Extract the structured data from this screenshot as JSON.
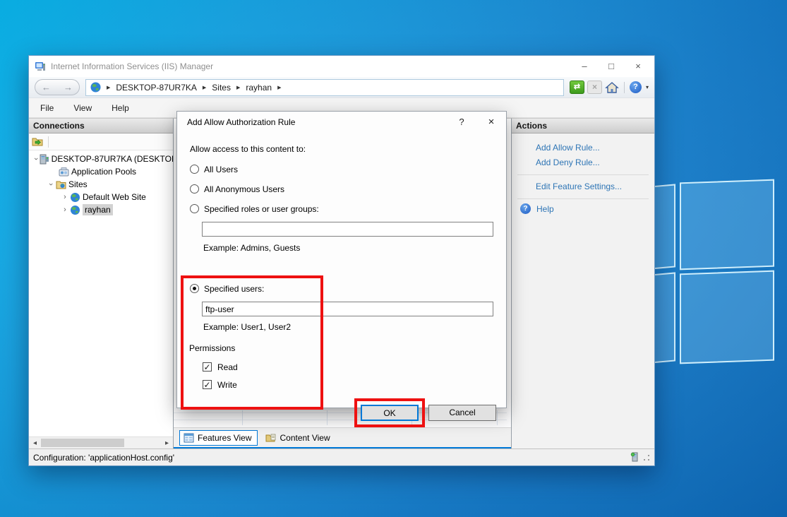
{
  "colors": {
    "highlight": "#ee1111",
    "link": "#2e75b5",
    "ok_border": "#0078d7"
  },
  "glyphs": {
    "back": "←",
    "forward": "→",
    "crumb_sep": "▶",
    "minimize": "–",
    "maximize": "□",
    "close": "×",
    "refresh": "⇄",
    "stop": "×",
    "help_q": "?",
    "dropdown": "▾",
    "chevron": "›",
    "check": "✓",
    "scroll_left": "◂",
    "scroll_right": "▸"
  },
  "window": {
    "title": "Internet Information Services (IIS) Manager",
    "breadcrumb": [
      "DESKTOP-87UR7KA",
      "Sites",
      "rayhan"
    ],
    "menu": [
      "File",
      "View",
      "Help"
    ]
  },
  "connections": {
    "header": "Connections",
    "tree": [
      {
        "label": "DESKTOP-87UR7KA (DESKTOP"
      },
      {
        "label": "Application Pools"
      },
      {
        "label": "Sites"
      },
      {
        "label": "Default Web Site"
      },
      {
        "label": "rayhan"
      }
    ]
  },
  "actions": {
    "header": "Actions",
    "links": [
      "Add Allow Rule...",
      "Add Deny Rule...",
      "Edit Feature Settings..."
    ],
    "help": "Help"
  },
  "dialog": {
    "title": "Add Allow Authorization Rule",
    "prompt": "Allow access to this content to:",
    "options": {
      "all_users": "All Users",
      "all_anonymous": "All Anonymous Users",
      "roles_label": "Specified roles or user groups:",
      "roles_value": "",
      "roles_example": "Example: Admins, Guests",
      "users_label": "Specified users:",
      "users_value": "ftp-user",
      "users_example": "Example: User1, User2"
    },
    "permissions": {
      "label": "Permissions",
      "read": "Read",
      "write": "Write"
    },
    "buttons": {
      "ok": "OK",
      "cancel": "Cancel"
    }
  },
  "footer": {
    "tabs": [
      "Features View",
      "Content View"
    ],
    "status": "Configuration: 'applicationHost.config'"
  }
}
